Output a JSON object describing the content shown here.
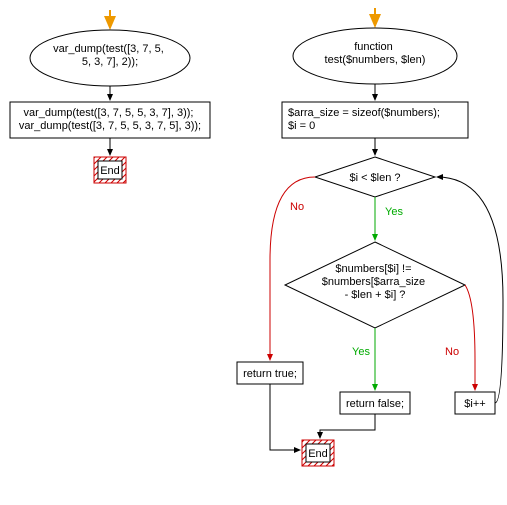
{
  "left": {
    "entry_call": "var_dump(test([3, 7, 5,\n5, 3, 7], 2));",
    "calls_block": "var_dump(test([3, 7, 5, 5, 3, 7], 3));\nvar_dump(test([3, 7, 5, 5, 3, 7, 5], 3));",
    "end": "End"
  },
  "right": {
    "func_header": "function\ntest($numbers, $len)",
    "init_block": "$arra_size = sizeof($numbers);\n$i = 0",
    "cond1": "$i < $len ?",
    "cond2": "$numbers[$i] !=\n$numbers[$arra_size\n- $len + $i] ?",
    "ret_true": "return true;",
    "ret_false": "return false;",
    "incr": "$i++",
    "end": "End",
    "yes": "Yes",
    "no": "No"
  }
}
